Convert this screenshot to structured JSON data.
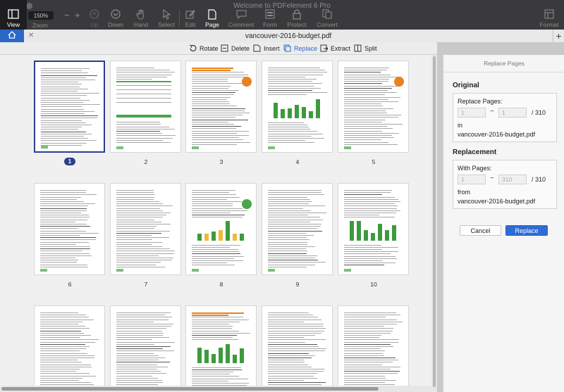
{
  "window": {
    "title": "Welcome to PDFelement 6 Pro"
  },
  "toolbar": {
    "view": "View",
    "zoom_value": "150%",
    "zoom_label": "Zoom",
    "up": "Up",
    "down": "Down",
    "hand": "Hand",
    "select": "Select",
    "edit": "Edit",
    "page": "Page",
    "comment": "Comment",
    "form": "Form",
    "protect": "Protect",
    "convert": "Convert",
    "format": "Format"
  },
  "tabs": {
    "document": "vancouver-2016-budget.pdf"
  },
  "page_toolbar": {
    "rotate": "Rotate",
    "delete": "Delete",
    "insert": "Insert",
    "replace": "Replace",
    "extract": "Extract",
    "split": "Split"
  },
  "pages": [
    "1",
    "2",
    "3",
    "4",
    "5",
    "6",
    "7",
    "8",
    "9",
    "10",
    "",
    "",
    "",
    "",
    ""
  ],
  "panel": {
    "title": "Replace Pages",
    "original_heading": "Original",
    "replace_pages_label": "Replace Pages:",
    "from_value": "1",
    "to_value": "1",
    "total": "/ 310",
    "in_label": "in",
    "original_file": "vancouver-2016-budget.pdf",
    "replacement_heading": "Replacement",
    "with_pages_label": "With Pages:",
    "with_from": "1",
    "with_to": "310",
    "with_total": "/ 310",
    "from_label": "from",
    "replacement_file": "vancouver-2016-budget.pdf",
    "tilde": "~",
    "cancel": "Cancel",
    "replace": "Replace"
  },
  "colors": {
    "accent": "#2b68c8",
    "selected_page": "#2b3f8f",
    "toolbar_bg": "#3a3a3c",
    "button_blue": "#2f6bd6"
  }
}
